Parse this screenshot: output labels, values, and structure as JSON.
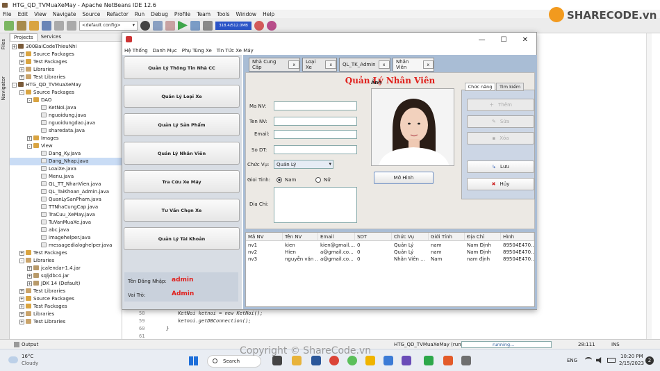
{
  "ide": {
    "title": "HTG_QD_TVMuaXeMay - Apache NetBeans IDE 12.6",
    "menu": [
      "File",
      "Edit",
      "View",
      "Navigate",
      "Source",
      "Refactor",
      "Run",
      "Debug",
      "Profile",
      "Team",
      "Tools",
      "Window",
      "Help"
    ],
    "config": "<default config>",
    "memory": "318.4/512.0MB",
    "side_tabs": [
      "Files",
      "Navigator"
    ],
    "panel_tabs": [
      "Projects",
      "Services"
    ],
    "tree": [
      {
        "indent": 0,
        "label": "300BaiCodeThieuNhi",
        "type": "proj",
        "tog": "+"
      },
      {
        "indent": 1,
        "label": "Source Packages",
        "type": "pkg",
        "tog": "+"
      },
      {
        "indent": 1,
        "label": "Test Packages",
        "type": "pkg",
        "tog": "+"
      },
      {
        "indent": 1,
        "label": "Libraries",
        "type": "lib",
        "tog": "+"
      },
      {
        "indent": 1,
        "label": "Test Libraries",
        "type": "lib",
        "tog": "+"
      },
      {
        "indent": 0,
        "label": "HTG_QD_TVMuaXeMay",
        "type": "proj",
        "tog": "-"
      },
      {
        "indent": 1,
        "label": "Source Packages",
        "type": "pkg",
        "tog": "-"
      },
      {
        "indent": 2,
        "label": "DAO",
        "type": "pkg",
        "tog": "-"
      },
      {
        "indent": 3,
        "label": "KetNoi.java",
        "type": "file"
      },
      {
        "indent": 3,
        "label": "nguoidung.java",
        "type": "file"
      },
      {
        "indent": 3,
        "label": "nguoidungdao.java",
        "type": "file"
      },
      {
        "indent": 3,
        "label": "sharedata.java",
        "type": "file"
      },
      {
        "indent": 2,
        "label": "Images",
        "type": "pkg",
        "tog": "+"
      },
      {
        "indent": 2,
        "label": "View",
        "type": "pkg",
        "tog": "-"
      },
      {
        "indent": 3,
        "label": "Dang_Ky.java",
        "type": "file"
      },
      {
        "indent": 3,
        "label": "Dang_Nhap.java",
        "type": "file",
        "sel": true
      },
      {
        "indent": 3,
        "label": "LoaiXe.java",
        "type": "file"
      },
      {
        "indent": 3,
        "label": "Menu.java",
        "type": "file"
      },
      {
        "indent": 3,
        "label": "QL_TT_NhanVien.java",
        "type": "file"
      },
      {
        "indent": 3,
        "label": "QL_TaiKhoan_Admin.java",
        "type": "file"
      },
      {
        "indent": 3,
        "label": "QuanLySanPham.java",
        "type": "file"
      },
      {
        "indent": 3,
        "label": "TTNhaCungCap.java",
        "type": "file"
      },
      {
        "indent": 3,
        "label": "TraCuu_XeMay.java",
        "type": "file"
      },
      {
        "indent": 3,
        "label": "TuVanMuaXe.java",
        "type": "file"
      },
      {
        "indent": 3,
        "label": "abc.java",
        "type": "file"
      },
      {
        "indent": 3,
        "label": "imagehelper.java",
        "type": "file"
      },
      {
        "indent": 3,
        "label": "messagedialoghelper.java",
        "type": "file"
      },
      {
        "indent": 1,
        "label": "Test Packages",
        "type": "pkg",
        "tog": "+"
      },
      {
        "indent": 1,
        "label": "Libraries",
        "type": "lib",
        "tog": "-"
      },
      {
        "indent": 2,
        "label": "jcalendar-1.4.jar",
        "type": "jar",
        "tog": "+"
      },
      {
        "indent": 2,
        "label": "sqljdbc4.jar",
        "type": "jar",
        "tog": "+"
      },
      {
        "indent": 2,
        "label": "JDK 14 (Default)",
        "type": "jar",
        "tog": "+"
      },
      {
        "indent": 1,
        "label": "Test Libraries",
        "type": "lib",
        "tog": "+"
      },
      {
        "indent": 1,
        "label": "Source Packages",
        "type": "pkg",
        "tog": "+"
      },
      {
        "indent": 1,
        "label": "Test Packages",
        "type": "pkg",
        "tog": "+"
      },
      {
        "indent": 1,
        "label": "Libraries",
        "type": "lib",
        "tog": "+"
      },
      {
        "indent": 1,
        "label": "Test Libraries",
        "type": "lib",
        "tog": "+"
      }
    ],
    "code_lines": [
      {
        "n": "58",
        "t": "        KetNoi ketnoi = new KetNoi();"
      },
      {
        "n": "59",
        "t": "        ketnoi.getDBConnection();"
      },
      {
        "n": "60",
        "t": "    }"
      },
      {
        "n": "61",
        "t": ""
      }
    ],
    "status": {
      "output": "Output",
      "project": "HTG_QD_TVMuaXeMay (run)",
      "running": "running...",
      "pos": "28:111",
      "mode": "INS"
    }
  },
  "taskbar": {
    "weather_temp": "16°C",
    "weather_desc": "Cloudy",
    "search": "Search",
    "lang": "ENG",
    "time": "10:20 PM",
    "date": "2/15/2023",
    "badge": "2"
  },
  "watermark": {
    "logo": "SHARECODE.vn",
    "copyright": "Copyright © ShareCode.vn",
    "mid": "ShareCode.vn"
  },
  "app": {
    "menu": [
      "Hệ Thống",
      "Danh Mục",
      "Phụ Tùng Xe",
      "Tin Tức Xe Máy"
    ],
    "nav": [
      "Quản Lý Thông Tin Nhà CC",
      "Quản Lý Loại Xe",
      "Quản Lý Sản Phẩm",
      "Quản Lý Nhân Viên",
      "Tra Cứu Xe Máy",
      "Tư Vấn Chọn Xe",
      "Quản Lý Tài Khoản"
    ],
    "login_label": "Tên Đăng Nhập:",
    "login_value": "admin",
    "role_label": "Vai Trò:",
    "role_value": "Admin",
    "tabs": [
      "Nhà Cung Cấp",
      "Loại Xe",
      "QL_TK_Admin",
      "Nhân Viên"
    ],
    "tab_close": "x",
    "form_title": "Quản Lý Nhân Viên",
    "fields": {
      "manv": "Ma NV:",
      "tennv": "Ten NV:",
      "email": "Email:",
      "sdt": "So DT:",
      "chucvu": "Chức Vụ:",
      "gioitinh": "Gioi Tinh:",
      "diachi": "Dia Chi:"
    },
    "chucvu_value": "Quản Lý",
    "gender": [
      "Nam",
      "Nữ"
    ],
    "photo_label": "Ảnh",
    "open_img": "Mở Hình",
    "func_tabs": [
      "Chức năng",
      "Tìm kiếm"
    ],
    "actions": {
      "them": "Thêm",
      "sua": "Sửa",
      "xoa": "Xóa",
      "luu": "Lưu",
      "huy": "Hủy"
    },
    "table": {
      "headers": [
        "Mã NV",
        "Tên NV",
        "Email",
        "SDT",
        "Chức Vụ",
        "Giới Tính",
        "Địa Chỉ",
        "Hình"
      ],
      "rows": [
        [
          "nv1",
          "kien",
          "kien@gmail....",
          "0",
          "Quản Lý",
          "nam",
          "Nam Định",
          "89504E470..."
        ],
        [
          "nv2",
          "Hien",
          "a@gmail.co...",
          "0",
          "Quản Lý",
          "nam",
          "Nam Định",
          "89504E470..."
        ],
        [
          "nv3",
          "nguyễn văn ...",
          "a@gmail.co...",
          "0",
          "Nhân Viên ...",
          "Nam",
          "nam định",
          "89504E470..."
        ]
      ]
    }
  }
}
